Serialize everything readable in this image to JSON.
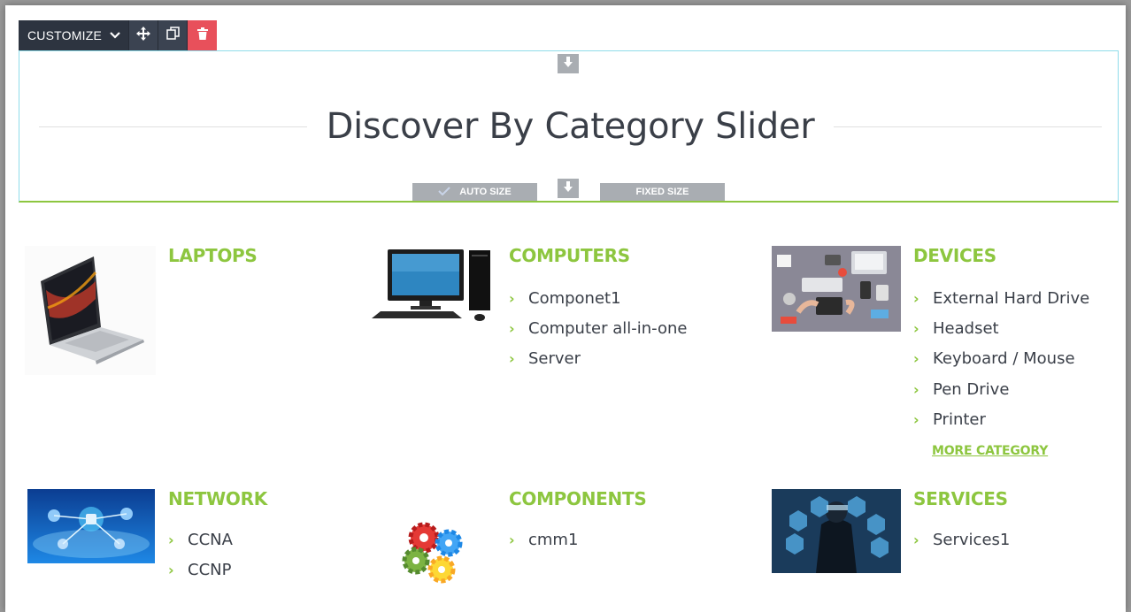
{
  "toolbar": {
    "customize_label": "CUSTOMIZE",
    "chevron_icon": "chevron-down-icon",
    "move_icon": "move-icon",
    "duplicate_icon": "duplicate-icon",
    "delete_icon": "trash-icon"
  },
  "heading": {
    "title": "Discover By Category Slider",
    "auto_size_label": "AUTO SIZE",
    "fixed_size_label": "FIXED SIZE"
  },
  "categories": [
    {
      "title": "LAPTOPS",
      "items": []
    },
    {
      "title": "COMPUTERS",
      "items": [
        "Componet1",
        "Computer all-in-one",
        "Server"
      ]
    },
    {
      "title": "DEVICES",
      "items": [
        "External Hard Drive",
        "Headset",
        "Keyboard / Mouse",
        "Pen Drive",
        "Printer"
      ],
      "more_label": "MORE CATEGORY"
    },
    {
      "title": "NETWORK",
      "items": [
        "CCNA",
        "CCNP"
      ]
    },
    {
      "title": "COMPONENTS",
      "items": [
        "cmm1"
      ]
    },
    {
      "title": "SERVICES",
      "items": [
        "Services1"
      ]
    }
  ],
  "colors": {
    "accent": "#8dc63f",
    "toolbar_dark": "#2d3440",
    "delete_red": "#e8505b",
    "selection_border": "#8fdcea"
  }
}
